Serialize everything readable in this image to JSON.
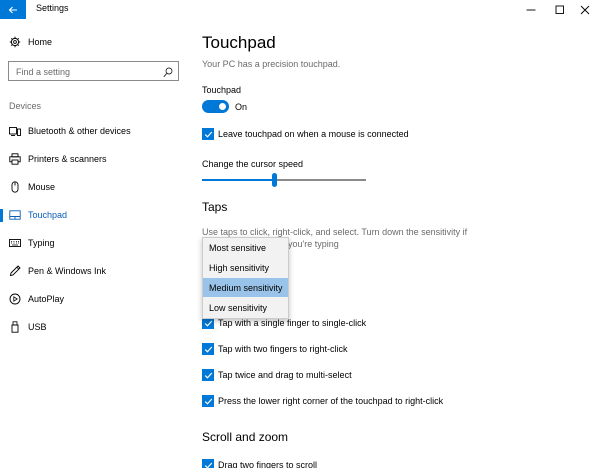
{
  "window": {
    "title": "Settings",
    "back_icon": "arrow-left-icon",
    "minimize_icon": "minimize-icon",
    "maximize_icon": "maximize-icon",
    "close_icon": "close-icon",
    "accent_color": "#0078d7"
  },
  "sidebar": {
    "home_label": "Home",
    "search_placeholder": "Find a setting",
    "section_label": "Devices",
    "items": [
      {
        "label": "Bluetooth & other devices",
        "icon": "bluetooth-device-icon"
      },
      {
        "label": "Printers & scanners",
        "icon": "printer-icon"
      },
      {
        "label": "Mouse",
        "icon": "mouse-icon"
      },
      {
        "label": "Touchpad",
        "icon": "touchpad-icon",
        "active": true
      },
      {
        "label": "Typing",
        "icon": "keyboard-icon"
      },
      {
        "label": "Pen & Windows Ink",
        "icon": "pen-icon"
      },
      {
        "label": "AutoPlay",
        "icon": "autoplay-icon"
      },
      {
        "label": "USB",
        "icon": "usb-icon"
      }
    ]
  },
  "main": {
    "title": "Touchpad",
    "subtitle": "Your PC has a precision touchpad.",
    "touchpad_label": "Touchpad",
    "touchpad_toggle_state": "On",
    "leave_on_label": "Leave touchpad on when a mouse is connected",
    "cursor_speed_label": "Change the cursor speed",
    "cursor_speed_fraction": 0.44,
    "taps_title": "Taps",
    "taps_desc_line1": "Use taps to click, right-click, and select. Turn down the sensitivity if",
    "taps_desc_line2": "you're typing",
    "sensitivity_options": [
      "Most sensitive",
      "High sensitivity",
      "Medium sensitivity",
      "Low sensitivity"
    ],
    "sensitivity_selected": "Medium sensitivity",
    "tap_checkboxes": [
      {
        "label": "Tap with a single finger to single-click",
        "checked": true
      },
      {
        "label": "Tap with two fingers to right-click",
        "checked": true
      },
      {
        "label": "Tap twice and drag to multi-select",
        "checked": true
      },
      {
        "label": "Press the lower right corner of the touchpad to right-click",
        "checked": true
      }
    ],
    "scroll_title": "Scroll and zoom",
    "scroll_checkbox_label": "Drag two fingers to scroll"
  }
}
